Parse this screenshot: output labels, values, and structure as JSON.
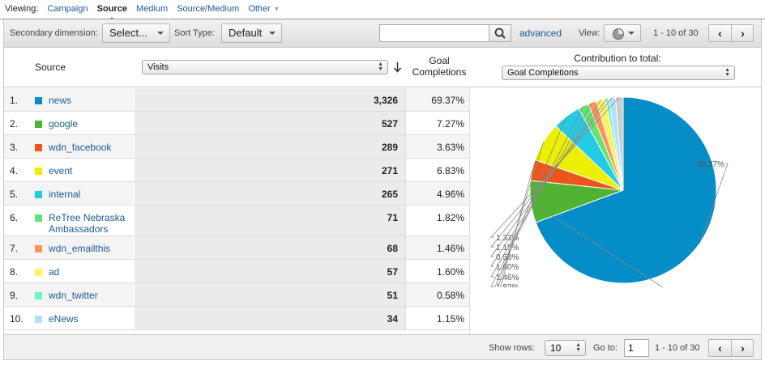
{
  "viewing": {
    "label": "Viewing:",
    "options": [
      "Campaign",
      "Source",
      "Medium",
      "Source/Medium",
      "Other"
    ],
    "active": "Source"
  },
  "toolbar": {
    "secondary_label": "Secondary dimension:",
    "secondary_value": "Select...",
    "sort_label": "Sort Type:",
    "sort_value": "Default",
    "search_value": "",
    "search_placeholder": "",
    "advanced": "advanced",
    "view_label": "View:",
    "range": "1 - 10 of 30"
  },
  "table": {
    "col_source": "Source",
    "metric_select": "Visits",
    "col_goal": "Goal Completions",
    "contribution_label": "Contribution to total:",
    "contribution_select": "Goal Completions",
    "rows": [
      {
        "num": "1.",
        "source": "news",
        "visits": "3,326",
        "pct": "69.37%",
        "color": "#058dc7"
      },
      {
        "num": "2.",
        "source": "google",
        "visits": "527",
        "pct": "7.27%",
        "color": "#50b432"
      },
      {
        "num": "3.",
        "source": "wdn_facebook",
        "visits": "289",
        "pct": "3.63%",
        "color": "#ed561b"
      },
      {
        "num": "4.",
        "source": "event",
        "visits": "271",
        "pct": "6.83%",
        "color": "#edef00"
      },
      {
        "num": "5.",
        "source": "internal",
        "visits": "265",
        "pct": "4.96%",
        "color": "#24cbe5"
      },
      {
        "num": "6.",
        "source": "ReTree Nebraska Ambassadors",
        "visits": "71",
        "pct": "1.82%",
        "color": "#64e572"
      },
      {
        "num": "7.",
        "source": "wdn_emailthis",
        "visits": "68",
        "pct": "1.46%",
        "color": "#ff9655"
      },
      {
        "num": "8.",
        "source": "ad",
        "visits": "57",
        "pct": "1.60%",
        "color": "#fff263"
      },
      {
        "num": "9.",
        "source": "wdn_twitter",
        "visits": "51",
        "pct": "0.58%",
        "color": "#6af9c4"
      },
      {
        "num": "10.",
        "source": "eNews",
        "visits": "34",
        "pct": "1.15%",
        "color": "#b2deff"
      }
    ]
  },
  "chart_data": {
    "type": "pie",
    "labels": [
      "news",
      "google",
      "wdn_facebook",
      "event",
      "internal",
      "ReTree Nebraska Ambassadors",
      "wdn_emailthis",
      "ad",
      "wdn_twitter",
      "eNews",
      "other"
    ],
    "values": [
      69.37,
      7.27,
      3.63,
      6.83,
      4.96,
      1.82,
      1.46,
      1.6,
      0.58,
      1.15,
      1.33
    ],
    "slice_labels": [
      "69.37%",
      "7.27%",
      "3.63%",
      "6.83%",
      "4.96%",
      "1.82%",
      "1.46%",
      "1.60%",
      "0.58%",
      "1.15%",
      "1.33%"
    ],
    "colors": [
      "#058dc7",
      "#50b432",
      "#ed561b",
      "#edef00",
      "#24cbe5",
      "#64e572",
      "#ff9655",
      "#fff263",
      "#6af9c4",
      "#b2deff",
      "#cccccc"
    ]
  },
  "footer": {
    "show_rows_label": "Show rows:",
    "show_rows_value": "10",
    "goto_label": "Go to:",
    "goto_value": "1",
    "range": "1 - 10 of 30"
  }
}
